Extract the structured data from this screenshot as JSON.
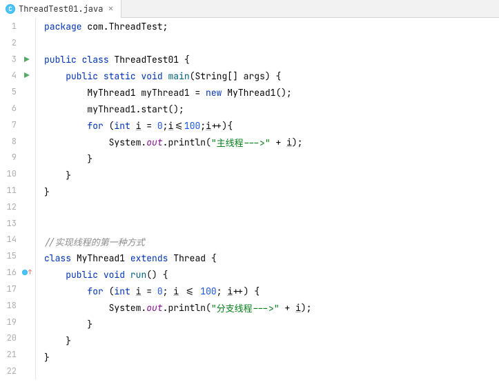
{
  "tab": {
    "icon_letter": "C",
    "filename": "ThreadTest01.java"
  },
  "lines": {
    "l1": {
      "package": "package",
      "pkg_name": " com.ThreadTest;"
    },
    "l3": {
      "public": "public",
      "class": "class",
      "name": "ThreadTest01",
      "brace": " {"
    },
    "l4": {
      "public": "public",
      "static": "static",
      "void": "void",
      "main": "main",
      "params": "(String[] args) {"
    },
    "l5": {
      "type": "MyThread1",
      "var": "myThread1",
      "eq": " = ",
      "new": "new",
      "ctor": "MyThread1",
      "end": "();"
    },
    "l6": {
      "call": "myThread1.start();"
    },
    "l7": {
      "for": "for",
      "open": " (",
      "int": "int",
      "var": "i",
      "eq_part": " = ",
      "zero": "0",
      "semi1": ";",
      "cond_var": "i",
      "cond_op": "<=",
      "hundred": "100",
      "semi2": ";",
      "inc_var": "i",
      "inc_op": "++){",
      "rest": ""
    },
    "l8": {
      "sys": "System.",
      "out": "out",
      "dot": ".",
      "println": "println",
      "open": "(",
      "str": "\"主线程--->\"",
      "plus": " + ",
      "var": "i",
      "end": ");"
    },
    "l9": {
      "brace": "}"
    },
    "l10": {
      "brace": "}"
    },
    "l11": {
      "brace": "}"
    },
    "l14": {
      "comment": "//实现线程的第一种方式"
    },
    "l15": {
      "class": "class",
      "name": "MyThread1",
      "extends": "extends",
      "parent": "Thread",
      "brace": " {"
    },
    "l16": {
      "public": "public",
      "void": "void",
      "run": "run",
      "params": "() {"
    },
    "l17": {
      "for": "for",
      "open": " (",
      "int": "int",
      "var": "i",
      "eq": " = ",
      "zero": "0",
      "semi1": "; ",
      "cv": "i",
      "cop": " <= ",
      "hundred": "100",
      "semi2": "; ",
      "iv": "i",
      "iop": "++) {"
    },
    "l18": {
      "sys": "System.",
      "out": "out",
      "dot": ".",
      "println": "println",
      "open": "(",
      "str": "\"分支线程--->\"",
      "plus": " + ",
      "var": "i",
      "end": ");"
    },
    "l19": {
      "brace": "}"
    },
    "l20": {
      "brace": "}"
    },
    "l21": {
      "brace": "}"
    }
  },
  "line_numbers": [
    "1",
    "2",
    "3",
    "4",
    "5",
    "6",
    "7",
    "8",
    "9",
    "10",
    "11",
    "12",
    "13",
    "14",
    "15",
    "16",
    "17",
    "18",
    "19",
    "20",
    "21",
    "22"
  ]
}
